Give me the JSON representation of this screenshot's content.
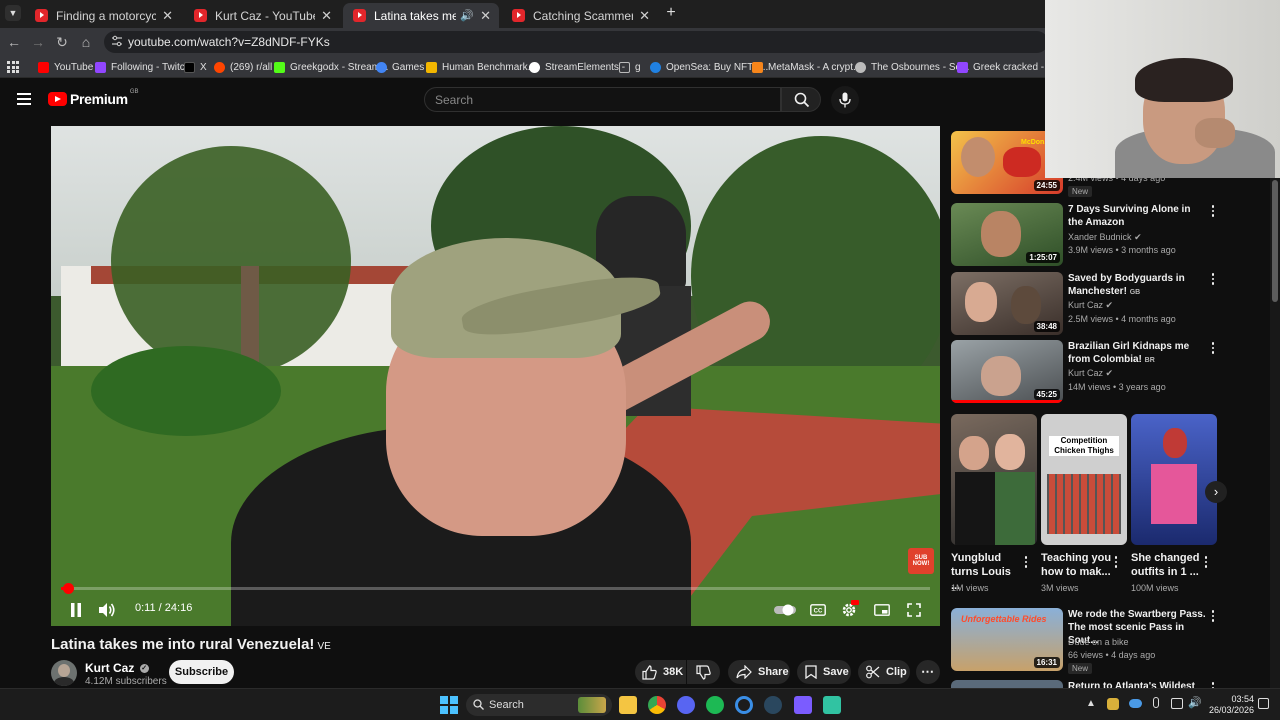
{
  "browser": {
    "tabs": [
      {
        "title": "Finding a motorcycle mechanic",
        "active": false
      },
      {
        "title": "Kurt Caz - YouTube",
        "active": false
      },
      {
        "title": "Latina takes me into rural V",
        "active": true
      },
      {
        "title": "Catching Scammers in Italy go",
        "active": false
      }
    ],
    "url": "youtube.com/watch?v=Z8dNDF-FYKs",
    "bookmarks": [
      {
        "label": "YouTube",
        "color": "#ff0000"
      },
      {
        "label": "Following - Twitch",
        "color": "#9146ff"
      },
      {
        "label": "X",
        "color": "#000000"
      },
      {
        "label": "(269) r/all",
        "color": "#ff4500"
      },
      {
        "label": "Greekgodx - Stream...",
        "color": "#53fc18"
      },
      {
        "label": "Games",
        "color": "#4285f4"
      },
      {
        "label": "Human Benchmark...",
        "color": "#f2b600"
      },
      {
        "label": "StreamElements -",
        "color": "#ffffff"
      },
      {
        "label": "g",
        "color": "#9aa0a6"
      },
      {
        "label": "OpenSea: Buy NFTs,...",
        "color": "#2081e2"
      },
      {
        "label": "MetaMask - A crypt...",
        "color": "#f6851b"
      },
      {
        "label": "The Osbournes - Se...",
        "color": "#bbbbbb"
      },
      {
        "label": "Greek cracked - Twi...",
        "color": "#9146ff"
      }
    ]
  },
  "youtube": {
    "logo_text": "Premium",
    "country_code": "GB",
    "search_placeholder": "Search"
  },
  "player": {
    "current_time": "0:11",
    "separator": "/",
    "duration": "24:16",
    "progress": 0.0076,
    "sub_now_label": "SUB NOW!"
  },
  "video": {
    "title": "Latina takes me into rural Venezuela!",
    "title_flag": "VE",
    "channel_name": "Kurt Caz",
    "subscribers": "4.12M subscribers",
    "subscribe_label": "Subscribe",
    "likes": "38K",
    "share_label": "Share",
    "save_label": "Save",
    "clip_label": "Clip"
  },
  "recommendations_top": [
    {
      "title": "",
      "channel": "",
      "meta": "2.4M views • 4 days ago",
      "duration": "24:55",
      "badge": "New",
      "thumb_label": "McDon..."
    },
    {
      "title": "7 Days Surviving Alone in the Amazon",
      "channel": "Xander Budnick",
      "meta": "3.9M views • 3 months ago",
      "duration": "1:25:07",
      "badge": ""
    },
    {
      "title": "Saved by Bodyguards in Manchester!",
      "title_flag": "GB",
      "channel": "Kurt Caz",
      "meta": "2.5M views • 4 months ago",
      "duration": "38:48",
      "badge": ""
    },
    {
      "title": "Brazilian Girl Kidnaps me from Colombia!",
      "title_flag": "BR",
      "channel": "Kurt Caz",
      "meta": "14M views • 3 years ago",
      "duration": "45:25",
      "badge": ""
    }
  ],
  "shorts": [
    {
      "title": "Yungblud turns Louis ...",
      "views": "1M views",
      "thumb_text": ""
    },
    {
      "title": "Teaching you how to mak...",
      "views": "3M views",
      "thumb_text": "Competition Chicken Thighs"
    },
    {
      "title": "She changed outfits in 1 ...",
      "views": "100M views",
      "thumb_text": ""
    }
  ],
  "recommendations_bottom": [
    {
      "title": "We rode the Swartberg Pass. The most scenic Pass in Sout...",
      "channel": "Dude on a bike",
      "meta": "66 views • 4 days ago",
      "duration": "16:31",
      "badge": "New",
      "thumb_text": "Unforgettable Rides"
    },
    {
      "title": "Return to Atlanta's Wildest Jail",
      "channel": "",
      "meta": "",
      "duration": "",
      "badge": ""
    }
  ],
  "taskbar": {
    "search_label": "Search",
    "time": "03:54",
    "date": "26/03/2026"
  },
  "colors": {
    "accent": "#ff0000",
    "background": "#0f0f0f",
    "chip": "#272727"
  }
}
